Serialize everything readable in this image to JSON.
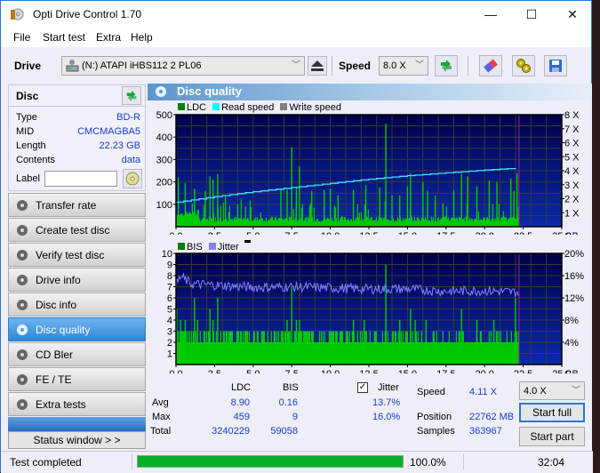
{
  "window": {
    "title": "Opti Drive Control 1.70",
    "controls": {
      "minimize": "—",
      "maximize": "☐",
      "close": "✕"
    }
  },
  "menu": [
    "File",
    "Start test",
    "Extra",
    "Help"
  ],
  "toolbar": {
    "drive_label": "Drive",
    "drive_value": "(N:)  ATAPI iHBS112  2 PL06",
    "speed_label": "Speed",
    "speed_value": "8.0 X",
    "icons": [
      "drive-icon",
      "eject-icon",
      "refresh-icon",
      "erase-icon",
      "settings-icon",
      "save-icon"
    ]
  },
  "disc": {
    "header": "Disc",
    "fields": [
      {
        "key": "Type",
        "value": "BD-R"
      },
      {
        "key": "MID",
        "value": "CMCMAGBA5"
      },
      {
        "key": "Length",
        "value": "22.23 GB"
      },
      {
        "key": "Contents",
        "value": "data"
      }
    ],
    "label_key": "Label",
    "label_value": ""
  },
  "nav": {
    "items": [
      {
        "label": "Transfer rate",
        "active": false
      },
      {
        "label": "Create test disc",
        "active": false
      },
      {
        "label": "Verify test disc",
        "active": false
      },
      {
        "label": "Drive info",
        "active": false
      },
      {
        "label": "Disc info",
        "active": false
      },
      {
        "label": "Disc quality",
        "active": true
      },
      {
        "label": "CD Bler",
        "active": false
      },
      {
        "label": "FE / TE",
        "active": false
      },
      {
        "label": "Extra tests",
        "active": false
      }
    ],
    "status_window": "Status window > >"
  },
  "panel": {
    "title": "Disc quality",
    "legend_top": [
      {
        "label": "LDC",
        "color": "#008000"
      },
      {
        "label": "Read speed",
        "color": "#00ffff"
      },
      {
        "label": "Write speed",
        "color": "#808080"
      }
    ],
    "legend_bottom": [
      {
        "label": "BIS",
        "color": "#008000"
      },
      {
        "label": "Jitter",
        "color": "#8080ff"
      }
    ]
  },
  "colors": {
    "plot_bg_top": "#00004a",
    "plot_bg_bottom": "#0a2aa8",
    "grid": "#3a3a3a",
    "bars": "#00cc00",
    "read_speed": "#40e0ff",
    "jitter": "#8080ff",
    "end_marker": "#a020a0",
    "accent": "#1a3ccc"
  },
  "chart_data": [
    {
      "type": "bar",
      "title": "LDC / Read speed",
      "xlabel": "GB",
      "x_ticks": [
        "0.0",
        "2.5",
        "5.0",
        "7.5",
        "10.0",
        "12.5",
        "15.0",
        "17.5",
        "20.0",
        "22.5",
        "25.0"
      ],
      "xlim": [
        0,
        25
      ],
      "y_left_ticks": [
        "100",
        "200",
        "300",
        "400",
        "500"
      ],
      "ylim_left": [
        0,
        500
      ],
      "y_right_ticks": [
        "1 X",
        "2 X",
        "3 X",
        "4 X",
        "5 X",
        "6 X",
        "7 X",
        "8 X"
      ],
      "ylim_right": [
        0,
        8
      ],
      "data_end_gb": 22.23,
      "series": [
        {
          "name": "LDC",
          "baseline_level": 40,
          "spikes": [
            {
              "x": 0.15,
              "y": 220
            },
            {
              "x": 0.6,
              "y": 195
            },
            {
              "x": 1.2,
              "y": 170
            },
            {
              "x": 1.9,
              "y": 160
            },
            {
              "x": 2.2,
              "y": 225
            },
            {
              "x": 2.4,
              "y": 210
            },
            {
              "x": 2.7,
              "y": 235
            },
            {
              "x": 3.2,
              "y": 135
            },
            {
              "x": 4.0,
              "y": 100
            },
            {
              "x": 6.8,
              "y": 165
            },
            {
              "x": 7.2,
              "y": 165
            },
            {
              "x": 7.5,
              "y": 355
            },
            {
              "x": 7.8,
              "y": 180
            },
            {
              "x": 8.0,
              "y": 270
            },
            {
              "x": 8.8,
              "y": 160
            },
            {
              "x": 9.6,
              "y": 165
            },
            {
              "x": 10.0,
              "y": 170
            },
            {
              "x": 10.5,
              "y": 140
            },
            {
              "x": 11.5,
              "y": 165
            },
            {
              "x": 12.3,
              "y": 185
            },
            {
              "x": 13.2,
              "y": 175
            },
            {
              "x": 13.6,
              "y": 460
            },
            {
              "x": 14.0,
              "y": 140
            },
            {
              "x": 14.5,
              "y": 140
            },
            {
              "x": 15.0,
              "y": 180
            },
            {
              "x": 15.2,
              "y": 240
            },
            {
              "x": 16.0,
              "y": 200
            },
            {
              "x": 16.3,
              "y": 160
            },
            {
              "x": 16.8,
              "y": 140
            },
            {
              "x": 17.3,
              "y": 105
            },
            {
              "x": 18.0,
              "y": 165
            },
            {
              "x": 18.5,
              "y": 235
            },
            {
              "x": 18.9,
              "y": 225
            },
            {
              "x": 19.5,
              "y": 180
            },
            {
              "x": 20.3,
              "y": 205
            },
            {
              "x": 20.8,
              "y": 200
            },
            {
              "x": 21.7,
              "y": 215
            },
            {
              "x": 21.9,
              "y": 160
            },
            {
              "x": 22.1,
              "y": 240
            }
          ]
        },
        {
          "name": "Read speed",
          "axis": "right",
          "points": [
            {
              "x": 0.0,
              "y": 1.75
            },
            {
              "x": 2.5,
              "y": 2.15
            },
            {
              "x": 5.0,
              "y": 2.5
            },
            {
              "x": 7.5,
              "y": 2.8
            },
            {
              "x": 10.0,
              "y": 3.1
            },
            {
              "x": 12.5,
              "y": 3.4
            },
            {
              "x": 15.0,
              "y": 3.65
            },
            {
              "x": 17.5,
              "y": 3.85
            },
            {
              "x": 20.0,
              "y": 4.05
            },
            {
              "x": 22.23,
              "y": 4.2
            }
          ]
        }
      ]
    },
    {
      "type": "bar",
      "title": "BIS / Jitter",
      "xlabel": "GB",
      "x_ticks": [
        "0.0",
        "2.5",
        "5.0",
        "7.5",
        "10.0",
        "12.5",
        "15.0",
        "17.5",
        "20.0",
        "22.5",
        "25.0"
      ],
      "xlim": [
        0,
        25
      ],
      "y_left_ticks": [
        "1",
        "2",
        "3",
        "4",
        "5",
        "6",
        "7",
        "8",
        "9",
        "10"
      ],
      "ylim_left": [
        0,
        10
      ],
      "y_right_ticks": [
        "4%",
        "8%",
        "12%",
        "16%",
        "20%"
      ],
      "ylim_right": [
        0,
        20
      ],
      "data_end_gb": 22.23,
      "series": [
        {
          "name": "BIS",
          "baseline_level": 2,
          "band_level": 3,
          "spikes": [
            {
              "x": 0.05,
              "y": 5
            },
            {
              "x": 0.3,
              "y": 4
            },
            {
              "x": 0.6,
              "y": 4
            },
            {
              "x": 1.2,
              "y": 6
            },
            {
              "x": 1.4,
              "y": 4
            },
            {
              "x": 2.2,
              "y": 5
            },
            {
              "x": 2.4,
              "y": 4
            },
            {
              "x": 2.7,
              "y": 6
            },
            {
              "x": 7.2,
              "y": 4
            },
            {
              "x": 7.5,
              "y": 7
            },
            {
              "x": 7.8,
              "y": 4
            },
            {
              "x": 8.0,
              "y": 4
            },
            {
              "x": 11.5,
              "y": 4
            },
            {
              "x": 12.2,
              "y": 4
            },
            {
              "x": 13.6,
              "y": 9
            },
            {
              "x": 14.5,
              "y": 4
            },
            {
              "x": 15.2,
              "y": 5
            },
            {
              "x": 15.5,
              "y": 4
            },
            {
              "x": 16.2,
              "y": 4
            },
            {
              "x": 18.5,
              "y": 5
            },
            {
              "x": 19.5,
              "y": 4
            },
            {
              "x": 20.6,
              "y": 4
            },
            {
              "x": 22.0,
              "y": 6
            }
          ]
        },
        {
          "name": "Jitter",
          "axis": "right",
          "avg": 13.7,
          "points": [
            {
              "x": 0.0,
              "y": 14.2
            },
            {
              "x": 0.3,
              "y": 15.8
            },
            {
              "x": 1.0,
              "y": 14.5
            },
            {
              "x": 2.5,
              "y": 14.3
            },
            {
              "x": 5.0,
              "y": 13.9
            },
            {
              "x": 7.5,
              "y": 14.0
            },
            {
              "x": 10.0,
              "y": 13.8
            },
            {
              "x": 12.5,
              "y": 13.6
            },
            {
              "x": 15.0,
              "y": 13.6
            },
            {
              "x": 17.5,
              "y": 13.2
            },
            {
              "x": 20.0,
              "y": 13.3
            },
            {
              "x": 22.23,
              "y": 13.0
            }
          ]
        }
      ]
    }
  ],
  "stats": {
    "col_ldc": "LDC",
    "col_bis": "BIS",
    "rows": [
      {
        "label": "Avg",
        "ldc": "8.90",
        "bis": "0.16",
        "jitter": "13.7%"
      },
      {
        "label": "Max",
        "ldc": "459",
        "bis": "9",
        "jitter": "16.0%"
      },
      {
        "label": "Total",
        "ldc": "3240229",
        "bis": "59058"
      }
    ],
    "jitter_label": "Jitter",
    "jitter_checked": true,
    "speed_label": "Speed",
    "speed_value": "4.11 X",
    "position_label": "Position",
    "position_value": "22762 MB",
    "samples_label": "Samples",
    "samples_value": "363967",
    "speed_select": "4.0 X",
    "start_full": "Start full",
    "start_part": "Start part"
  },
  "statusbar": {
    "message": "Test completed",
    "progress_percent": 100,
    "progress_text": "100.0%",
    "elapsed": "32:04"
  }
}
